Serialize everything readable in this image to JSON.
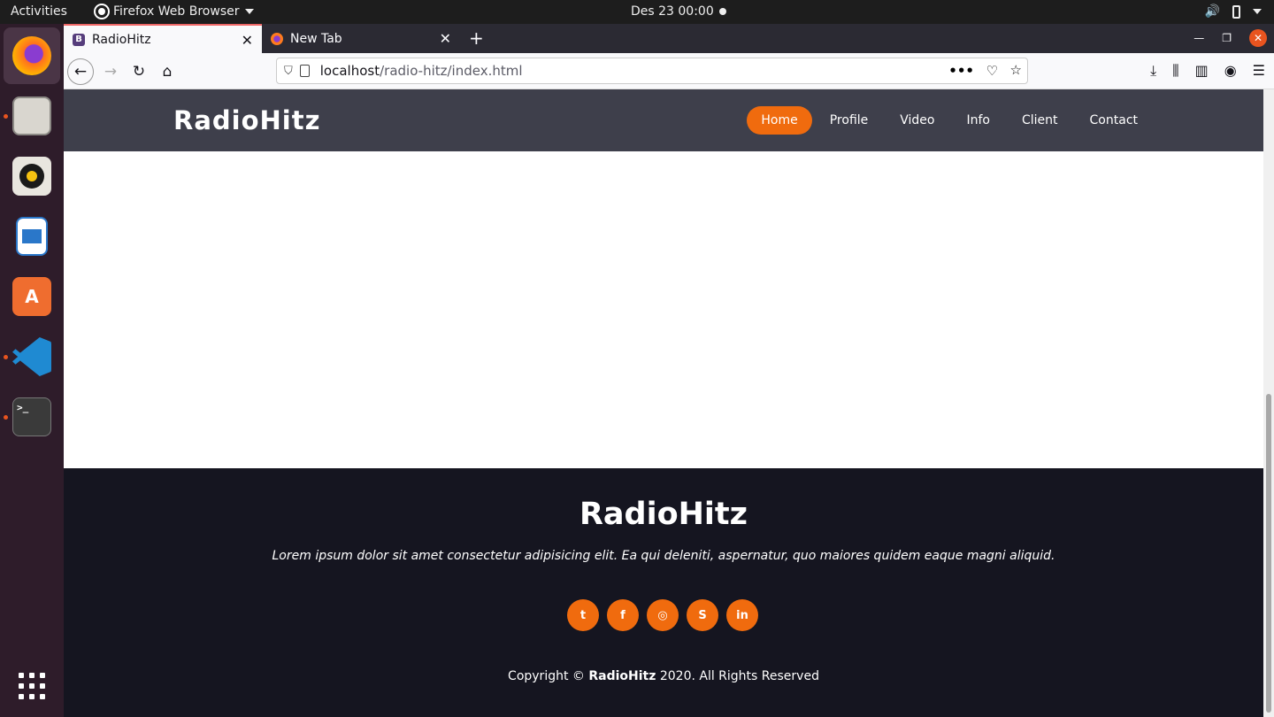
{
  "topbar": {
    "activities": "Activities",
    "app_name": "Firefox Web Browser",
    "clock": "Des 23  00:00"
  },
  "browser": {
    "tabs": [
      {
        "title": "RadioHitz",
        "favicon": "B"
      },
      {
        "title": "New Tab"
      }
    ],
    "url_host": "localhost",
    "url_path": "/radio-hitz/index.html"
  },
  "site": {
    "logo": "RadioHitz",
    "nav": [
      "Home",
      "Profile",
      "Video",
      "Info",
      "Client",
      "Contact"
    ],
    "active_nav": "Home",
    "accent_color": "#f06b0e",
    "footer": {
      "title": "RadioHitz",
      "text": "Lorem ipsum dolor sit amet consectetur adipisicing elit. Ea qui deleniti, aspernatur, quo maiores quidem eaque magni aliquid.",
      "social": [
        "twitter-icon",
        "facebook-icon",
        "instagram-icon",
        "skype-icon",
        "linkedin-icon"
      ],
      "copyright_prefix": "Copyright ©",
      "copyright_brand": "RadioHitz",
      "copyright_suffix": "2020. All Rights Reserved"
    }
  }
}
